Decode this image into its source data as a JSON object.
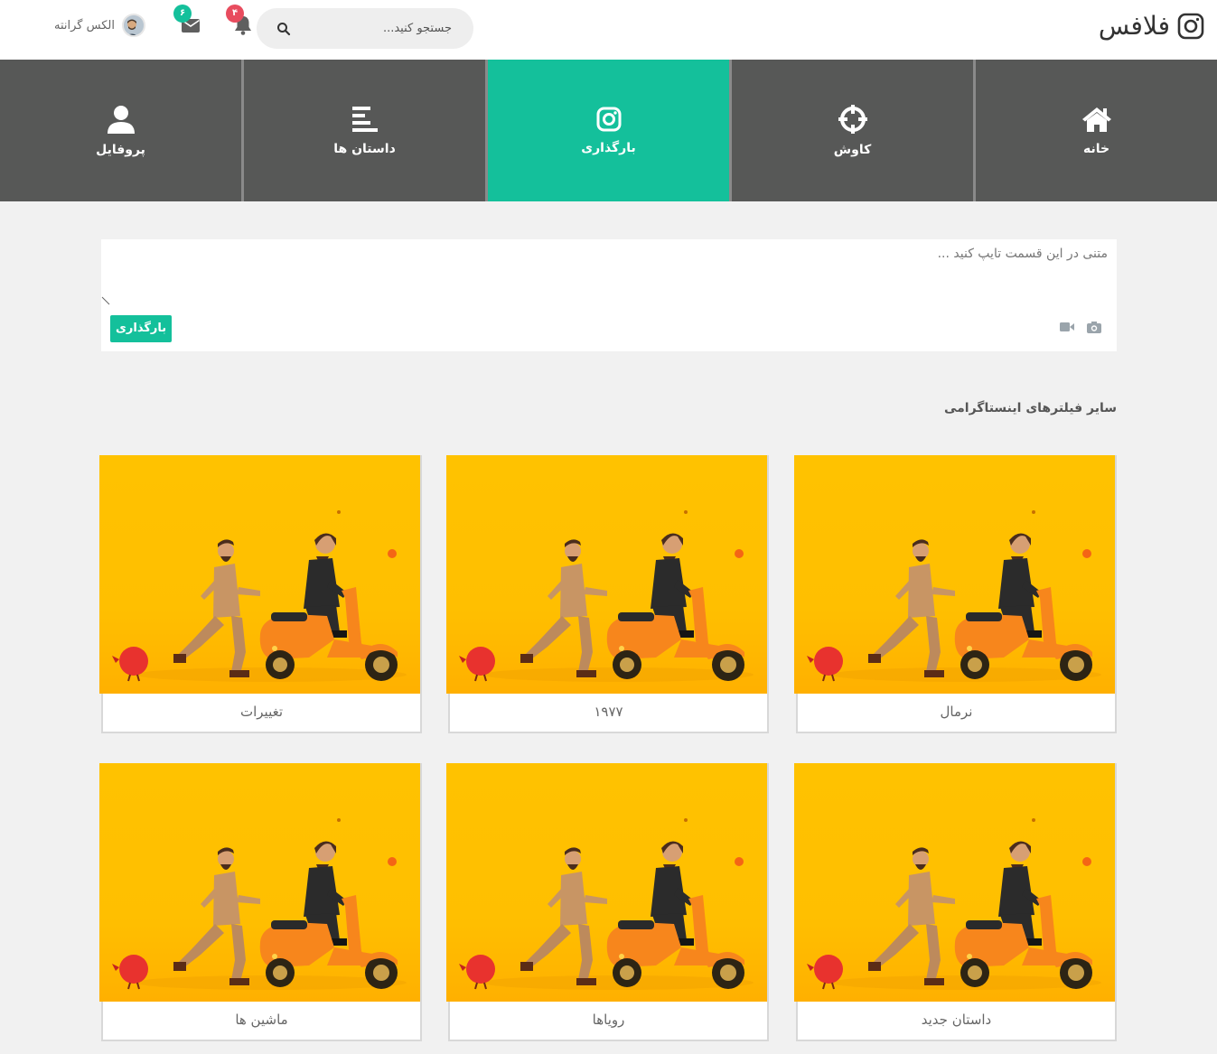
{
  "brand": {
    "name": "فلافس"
  },
  "search": {
    "placeholder": "جستجو کنید..."
  },
  "notifications": {
    "count": "۴"
  },
  "messages": {
    "count": "۶"
  },
  "user": {
    "name": "الکس گرانته"
  },
  "nav": {
    "items": [
      {
        "label": "خانه",
        "icon": "home-icon"
      },
      {
        "label": "کاوش",
        "icon": "crosshair-icon"
      },
      {
        "label": "بارگذاری",
        "icon": "instagram-icon",
        "active": true
      },
      {
        "label": "داستان ها",
        "icon": "align-left-icon"
      },
      {
        "label": "پروفایل",
        "icon": "user-icon"
      }
    ]
  },
  "composer": {
    "placeholder": "متنی در این قسمت تایپ کنید ...",
    "upload_label": "بارگذاری"
  },
  "filters": {
    "title": "سایر فیلترهای اینستاگرامی",
    "items": [
      {
        "label": "نرمال"
      },
      {
        "label": "۱۹۷۷"
      },
      {
        "label": "تغییرات"
      },
      {
        "label": "داستان جدید"
      },
      {
        "label": "رویاها"
      },
      {
        "label": "ماشین ها"
      }
    ]
  },
  "colors": {
    "accent": "#14c09b",
    "nav_bg": "#575857",
    "badge_red": "#e84c5e",
    "badge_green": "#14c09b",
    "image_bg": "#ffc200"
  }
}
